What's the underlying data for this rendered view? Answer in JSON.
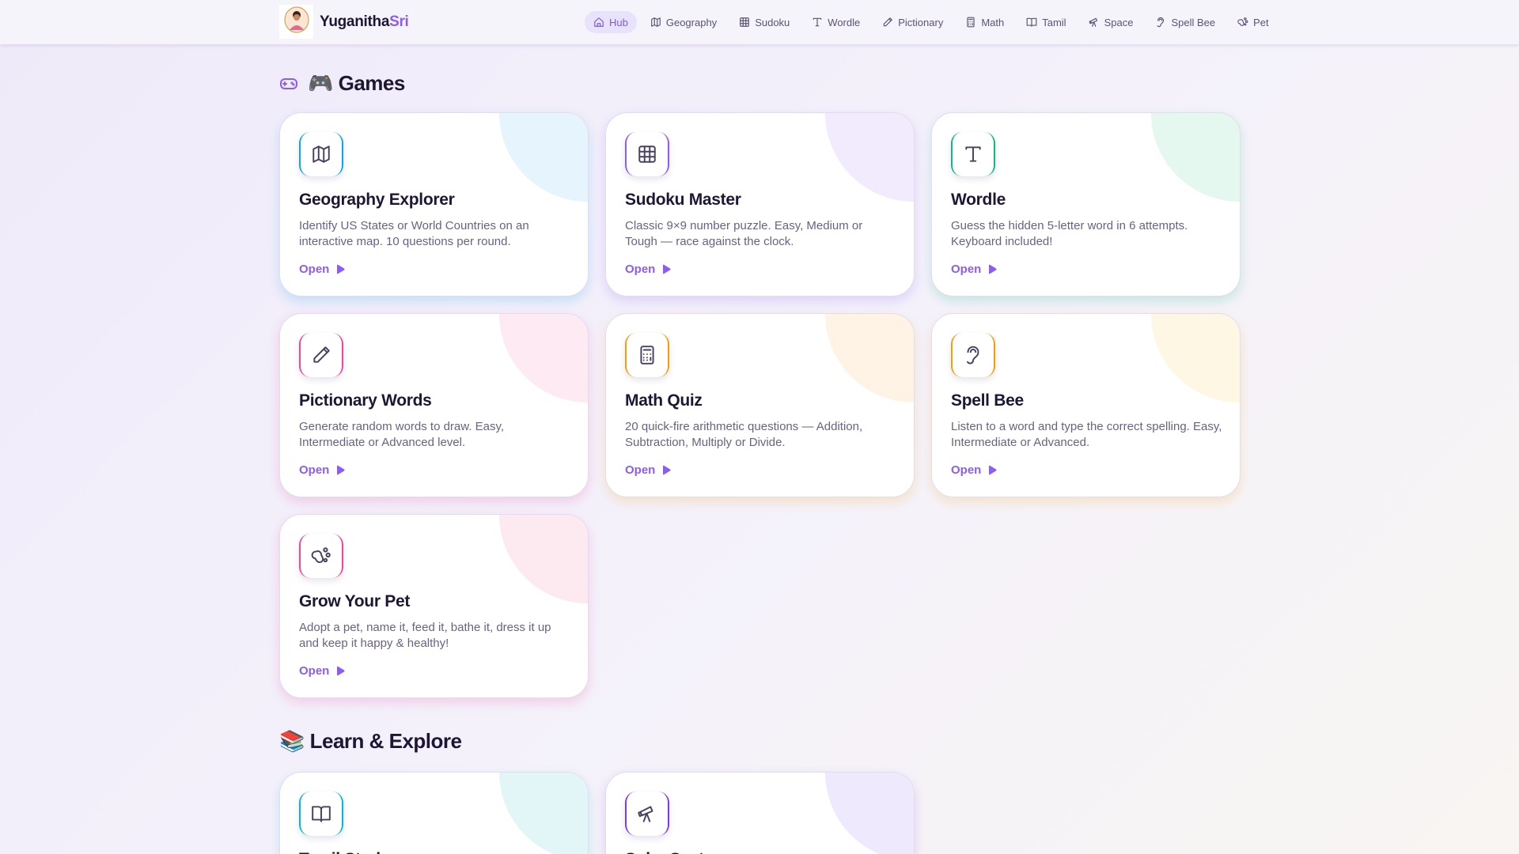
{
  "brand": {
    "name": "Yuganitha",
    "accent": "Sri",
    "logo_caption": "YuganithaSri"
  },
  "nav": [
    {
      "label": "Hub",
      "icon": "home-icon",
      "active": true
    },
    {
      "label": "Geography",
      "icon": "map-icon"
    },
    {
      "label": "Sudoku",
      "icon": "grid-icon"
    },
    {
      "label": "Wordle",
      "icon": "type-icon"
    },
    {
      "label": "Pictionary",
      "icon": "pencil-icon"
    },
    {
      "label": "Math",
      "icon": "calculator-icon"
    },
    {
      "label": "Tamil",
      "icon": "book-icon"
    },
    {
      "label": "Space",
      "icon": "telescope-icon"
    },
    {
      "label": "Spell Bee",
      "icon": "ear-icon"
    },
    {
      "label": "Pet",
      "icon": "paw-icon"
    }
  ],
  "sections": {
    "games": "🎮 Games",
    "learn": "📚 Learn & Explore"
  },
  "open_label": "Open",
  "games": [
    {
      "title": "Geography Explorer",
      "desc": "Identify US States or World Countries on an interactive map. 10 questions per round.",
      "icon": "map-icon",
      "color": "#0ea5e9",
      "tint": "#e5f4fd"
    },
    {
      "title": "Sudoku Master",
      "desc": "Classic 9×9 number puzzle. Easy, Medium or Tough — race against the clock.",
      "icon": "grid-icon",
      "color": "#8b5cf6",
      "tint": "#f1ebfd"
    },
    {
      "title": "Wordle",
      "desc": "Guess the hidden 5-letter word in 6 attempts. Keyboard included!",
      "icon": "type-icon",
      "color": "#10b981",
      "tint": "#e4f8ef"
    },
    {
      "title": "Pictionary Words",
      "desc": "Generate random words to draw. Easy, Intermediate or Advanced level.",
      "icon": "pencil-icon",
      "color": "#ec4899",
      "tint": "#fdeaf3"
    },
    {
      "title": "Math Quiz",
      "desc": "20 quick-fire arithmetic questions — Addition, Subtraction, Multiply or Divide.",
      "icon": "calculator-icon",
      "color": "#f59e0b",
      "tint": "#fef3e4"
    },
    {
      "title": "Spell Bee",
      "desc": "Listen to a word and type the correct spelling. Easy, Intermediate or Advanced.",
      "icon": "ear-icon",
      "color": "#f59e0b",
      "tint": "#fef7e4"
    },
    {
      "title": "Grow Your Pet",
      "desc": "Adopt a pet, name it, feed it, bathe it, dress it up and keep it happy & healthy!",
      "icon": "paw-icon",
      "color": "#ec4899",
      "tint": "#fdeaf1"
    }
  ],
  "learn": [
    {
      "title": "Tamil Study",
      "icon": "book-icon",
      "color": "#06b6d4",
      "tint": "#e3f6f7"
    },
    {
      "title": "Solar System",
      "icon": "telescope-icon",
      "color": "#7c3aed",
      "tint": "#eee9fc"
    }
  ]
}
